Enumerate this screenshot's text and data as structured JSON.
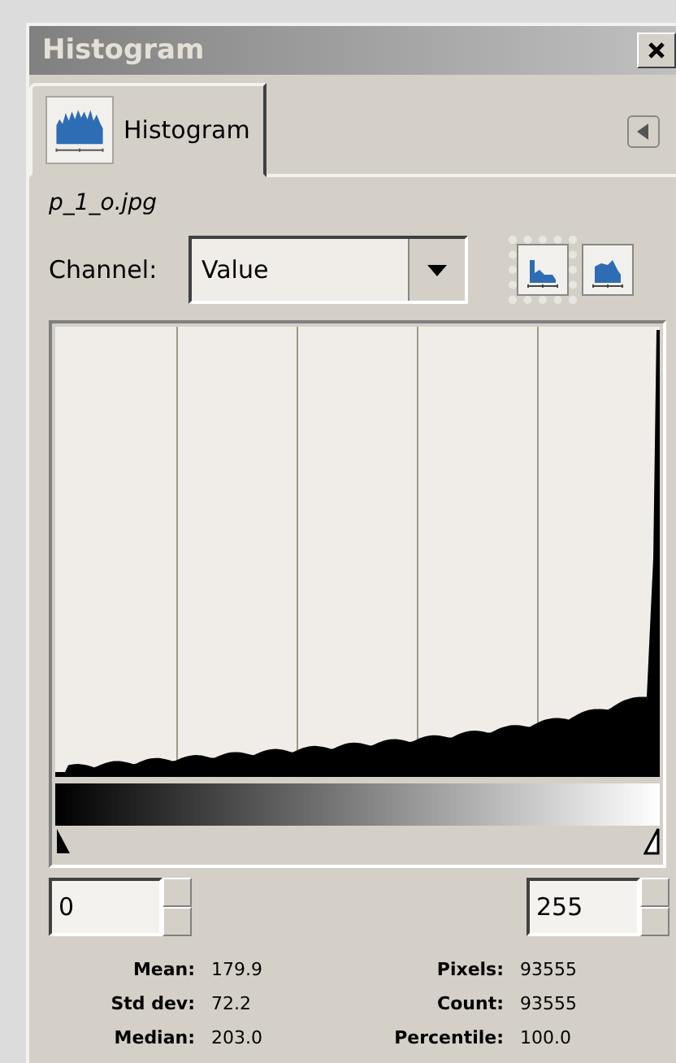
{
  "window": {
    "title": "Histogram"
  },
  "tabs": [
    {
      "label": "Histogram",
      "selected": true
    }
  ],
  "image_name": "p_1_o.jpg",
  "channel": {
    "label": "Channel:",
    "value": "Value"
  },
  "scale_buttons": [
    {
      "kind": "linear",
      "selected": true
    },
    {
      "kind": "log",
      "selected": false
    }
  ],
  "range": {
    "low": "0",
    "high": "255"
  },
  "stats_left": [
    {
      "label": "Mean:",
      "value": "179.9"
    },
    {
      "label": "Std dev:",
      "value": "72.2"
    },
    {
      "label": "Median:",
      "value": "203.0"
    }
  ],
  "stats_right": [
    {
      "label": "Pixels:",
      "value": "93555"
    },
    {
      "label": "Count:",
      "value": "93555"
    },
    {
      "label": "Percentile:",
      "value": "100.0"
    }
  ]
}
